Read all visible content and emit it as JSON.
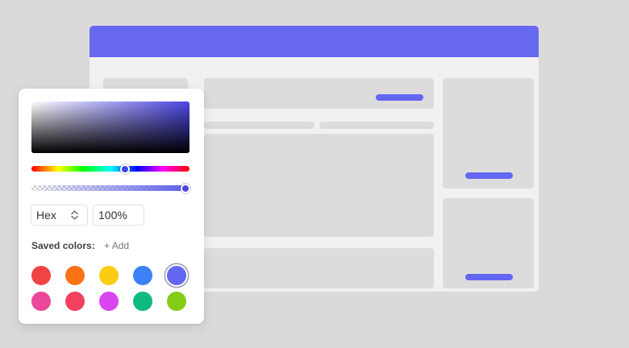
{
  "picker": {
    "format_value": "Hex",
    "alpha_value": "100%",
    "saved_label": "Saved colors:",
    "add_label": "+ Add",
    "selected_color": "#6366f1",
    "hue_value": 0.67,
    "alpha_level": 1.0,
    "swatches": [
      {
        "color": "#ef4444"
      },
      {
        "color": "#f97316"
      },
      {
        "color": "#facc15"
      },
      {
        "color": "#3b82f6"
      },
      {
        "color": "#6366f1",
        "selected": true
      },
      {
        "color": "#ec4899"
      },
      {
        "color": "#f43f5e"
      },
      {
        "color": "#d946ef"
      },
      {
        "color": "#10b981"
      },
      {
        "color": "#84cc16"
      }
    ]
  },
  "theme": {
    "accent": "#6366f1",
    "header": "#6769f1"
  }
}
